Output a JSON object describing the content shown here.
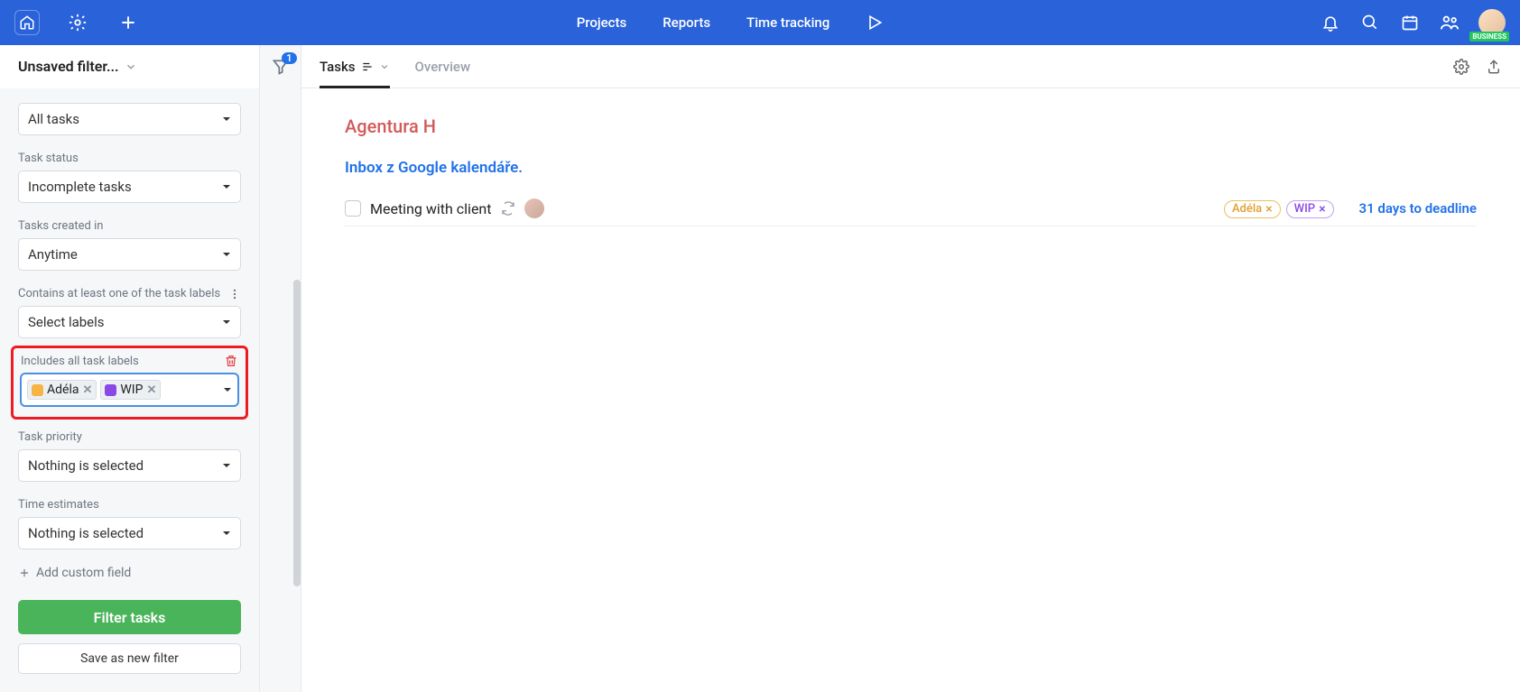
{
  "topbar": {
    "nav": {
      "projects": "Projects",
      "reports": "Reports",
      "timetracking": "Time tracking"
    },
    "business_badge": "BUSINESS"
  },
  "sidebar": {
    "title": "Unsaved filter...",
    "funnel_badge": "1",
    "scope": "All tasks",
    "status_label": "Task status",
    "status_value": "Incomplete tasks",
    "created_label": "Tasks created in",
    "created_value": "Anytime",
    "contains_label": "Contains at least one of the task labels",
    "contains_value": "Select labels",
    "includes_label": "Includes all task labels",
    "includes_chips": [
      {
        "name": "Adéla",
        "color": "#f5b443"
      },
      {
        "name": "WIP",
        "color": "#8a48e6"
      }
    ],
    "priority_label": "Task priority",
    "priority_value": "Nothing is selected",
    "estimates_label": "Time estimates",
    "estimates_value": "Nothing is selected",
    "add_custom": "Add custom field",
    "filter_btn": "Filter tasks",
    "save_btn": "Save as new filter"
  },
  "tabs": {
    "tasks": "Tasks",
    "overview": "Overview"
  },
  "main": {
    "project_title": "Agentura H",
    "section_title": "Inbox z Google kalendáře.",
    "task": {
      "name": "Meeting with client",
      "labels": [
        {
          "name": "Adéla",
          "bg": "#fff",
          "fg": "#e0a030",
          "border": "#e8c060"
        },
        {
          "name": "WIP",
          "bg": "#fff",
          "fg": "#8a48e6",
          "border": "#bda0ee"
        }
      ],
      "deadline": "31 days to deadline"
    }
  }
}
